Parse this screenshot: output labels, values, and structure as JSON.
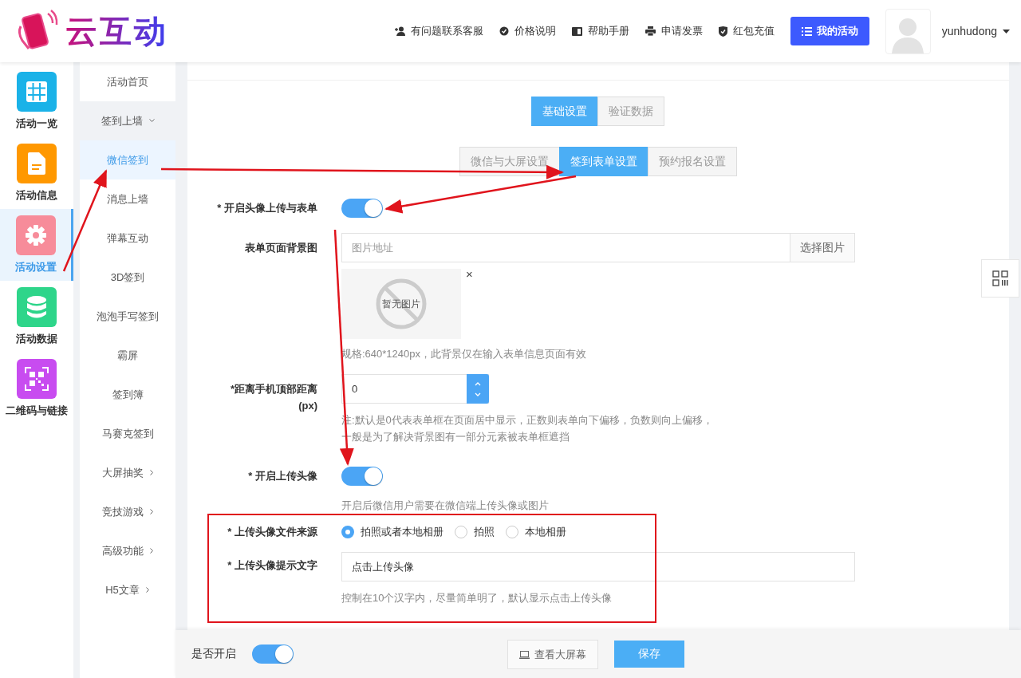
{
  "logo": {
    "text": "云互动"
  },
  "top_nav": [
    {
      "kind": "user",
      "label": "有问题联系客服"
    },
    {
      "kind": "badge",
      "label": "价格说明"
    },
    {
      "kind": "book",
      "label": "帮助手册"
    },
    {
      "kind": "printer",
      "label": "申请发票"
    },
    {
      "kind": "shield",
      "label": "红包充值"
    }
  ],
  "my_activity_button": "我的活动",
  "user": {
    "name": "yunhudong"
  },
  "icon_sidebar": [
    {
      "kind": "grid",
      "label": "活动一览",
      "color": "#1ab2e8",
      "selected": false
    },
    {
      "kind": "doc",
      "label": "活动信息",
      "color": "#ff9800",
      "selected": false
    },
    {
      "kind": "gear",
      "label": "活动设置",
      "color": "#f78c9a",
      "selected": true
    },
    {
      "kind": "db",
      "label": "活动数据",
      "color": "#2ed58a",
      "selected": false
    },
    {
      "kind": "qr",
      "label": "二维码与链接",
      "color": "#c84cf0",
      "selected": false
    }
  ],
  "sub_menu": [
    {
      "label": "活动首页",
      "selected": false
    },
    {
      "label": "签到上墙",
      "selected": false,
      "expanded": true
    },
    {
      "label": "微信签到",
      "selected": true
    },
    {
      "label": "消息上墙",
      "selected": false
    },
    {
      "label": "弹幕互动",
      "selected": false
    },
    {
      "label": "3D签到",
      "selected": false
    },
    {
      "label": "泡泡手写签到",
      "selected": false
    },
    {
      "label": "霸屏",
      "selected": false
    },
    {
      "label": "签到簿",
      "selected": false
    },
    {
      "label": "马赛克签到",
      "selected": false
    },
    {
      "label": "大屏抽奖",
      "selected": false,
      "expanded": false
    },
    {
      "label": "竞技游戏",
      "selected": false,
      "expanded": false
    },
    {
      "label": "高级功能",
      "selected": false,
      "expanded": false
    },
    {
      "label": "H5文章",
      "selected": false,
      "expanded": false
    }
  ],
  "primary_tabs": [
    {
      "label": "基础设置",
      "selected": true
    },
    {
      "label": "验证数据",
      "selected": false
    }
  ],
  "secondary_tabs": [
    {
      "label": "微信与大屏设置",
      "selected": false
    },
    {
      "label": "签到表单设置",
      "selected": true
    },
    {
      "label": "预约报名设置",
      "selected": false
    }
  ],
  "form": [
    {
      "kind": "toggle",
      "label": "* 开启头像上传与表单",
      "on": true
    },
    {
      "kind": "image",
      "label": "表单页面背景图",
      "placeholder": "图片地址",
      "button": "选择图片",
      "preview_text": "暂无图片",
      "remove": "×",
      "hint": "规格:640*1240px，此背景仅在输入表单信息页面有效"
    },
    {
      "kind": "number",
      "label": "*距离手机顶部距离 (px)",
      "value": "0",
      "hint": "注:默认是0代表表单框在页面居中显示，正数则表单向下偏移，负数则向上偏移，一般是为了解决背景图有一部分元素被表单框遮挡"
    },
    {
      "kind": "toggle",
      "label": "* 开启上传头像",
      "on": true,
      "hint": "开启后微信用户需要在微信端上传头像或图片"
    },
    {
      "kind": "radio",
      "label": "* 上传头像文件来源",
      "options": [
        {
          "label": "拍照或者本地相册",
          "selected": true
        },
        {
          "label": "拍照",
          "selected": false
        },
        {
          "label": "本地相册",
          "selected": false
        }
      ]
    },
    {
      "kind": "text",
      "label": "* 上传头像提示文字",
      "value": "点击上传头像",
      "hint": "控制在10个汉字内，尽量简单明了，默认显示点击上传头像"
    }
  ],
  "bottom_bar": {
    "label": "是否开启",
    "on": true,
    "preview_button": "查看大屏幕",
    "save_button": "保存"
  }
}
